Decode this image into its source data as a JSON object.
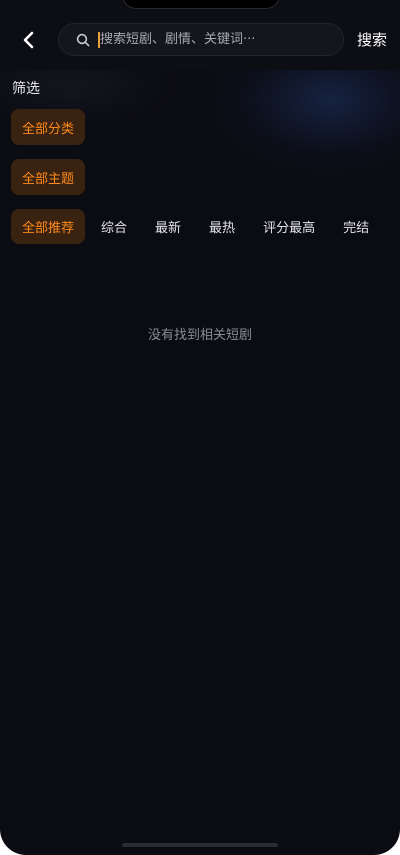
{
  "header": {
    "back_icon": "chevron-left-icon",
    "search_icon": "search-icon",
    "search_placeholder": "搜索短剧、剧情、关键词···",
    "search_value": "",
    "search_button": "搜索"
  },
  "filters": {
    "title": "筛选",
    "category": "全部分类",
    "theme": "全部主题",
    "recommend": "全部推荐",
    "sort_tabs": [
      "综合",
      "最新",
      "最热",
      "评分最高",
      "完结"
    ]
  },
  "empty_state": "没有找到相关短剧",
  "colors": {
    "background": "#0b0c12",
    "chip_background": "#3a2210",
    "chip_text": "#ff8a1d",
    "caret": "#e8a33c"
  }
}
